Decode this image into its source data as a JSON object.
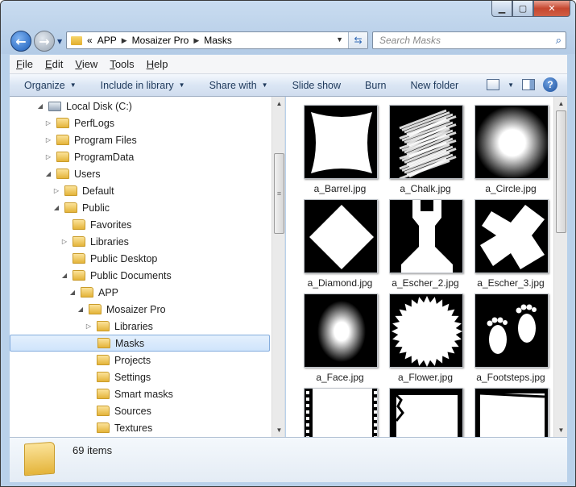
{
  "window": {
    "address": {
      "crumbs": [
        "APP",
        "Mosaizer Pro",
        "Masks"
      ],
      "overflow": "«"
    },
    "search_placeholder": "Search Masks"
  },
  "menu": [
    {
      "label": "File",
      "key": "F"
    },
    {
      "label": "Edit",
      "key": "E"
    },
    {
      "label": "View",
      "key": "V"
    },
    {
      "label": "Tools",
      "key": "T"
    },
    {
      "label": "Help",
      "key": "H"
    }
  ],
  "commands": {
    "organize": "Organize",
    "include": "Include in library",
    "share": "Share with",
    "slideshow": "Slide show",
    "burn": "Burn",
    "newfolder": "New folder"
  },
  "tree": [
    {
      "label": "Local Disk (C:)",
      "indent": 0,
      "expander": "open",
      "icon": "disk"
    },
    {
      "label": "PerfLogs",
      "indent": 1,
      "expander": "closed",
      "icon": "folder"
    },
    {
      "label": "Program Files",
      "indent": 1,
      "expander": "closed",
      "icon": "folder"
    },
    {
      "label": "ProgramData",
      "indent": 1,
      "expander": "closed",
      "icon": "folder"
    },
    {
      "label": "Users",
      "indent": 1,
      "expander": "open",
      "icon": "folder"
    },
    {
      "label": "Default",
      "indent": 2,
      "expander": "closed",
      "icon": "folder"
    },
    {
      "label": "Public",
      "indent": 2,
      "expander": "open",
      "icon": "folder"
    },
    {
      "label": "Favorites",
      "indent": 3,
      "expander": "none",
      "icon": "folder"
    },
    {
      "label": "Libraries",
      "indent": 3,
      "expander": "closed",
      "icon": "folder"
    },
    {
      "label": "Public Desktop",
      "indent": 3,
      "expander": "none",
      "icon": "folder"
    },
    {
      "label": "Public Documents",
      "indent": 3,
      "expander": "open",
      "icon": "folder"
    },
    {
      "label": "APP",
      "indent": 4,
      "expander": "open",
      "icon": "folder"
    },
    {
      "label": "Mosaizer Pro",
      "indent": 5,
      "expander": "open",
      "icon": "folder"
    },
    {
      "label": "Libraries",
      "indent": 6,
      "expander": "closed",
      "icon": "folder"
    },
    {
      "label": "Masks",
      "indent": 6,
      "expander": "none",
      "icon": "folder",
      "selected": true
    },
    {
      "label": "Projects",
      "indent": 6,
      "expander": "none",
      "icon": "folder"
    },
    {
      "label": "Settings",
      "indent": 6,
      "expander": "none",
      "icon": "folder"
    },
    {
      "label": "Smart masks",
      "indent": 6,
      "expander": "none",
      "icon": "folder"
    },
    {
      "label": "Sources",
      "indent": 6,
      "expander": "none",
      "icon": "folder"
    },
    {
      "label": "Textures",
      "indent": 6,
      "expander": "none",
      "icon": "folder"
    }
  ],
  "files": [
    {
      "name": "a_Barrel.jpg",
      "shape": "barrel"
    },
    {
      "name": "a_Chalk.jpg",
      "shape": "chalk"
    },
    {
      "name": "a_Circle.jpg",
      "shape": "circle"
    },
    {
      "name": "a_Diamond.jpg",
      "shape": "diamond"
    },
    {
      "name": "a_Escher_2.jpg",
      "shape": "escher2"
    },
    {
      "name": "a_Escher_3.jpg",
      "shape": "escher3"
    },
    {
      "name": "a_Face.jpg",
      "shape": "face"
    },
    {
      "name": "a_Flower.jpg",
      "shape": "flower"
    },
    {
      "name": "a_Footsteps.jpg",
      "shape": "footsteps"
    },
    {
      "name": "",
      "shape": "film"
    },
    {
      "name": "",
      "shape": "grunge1"
    },
    {
      "name": "",
      "shape": "grunge2"
    }
  ],
  "details": {
    "count": "69 items"
  }
}
